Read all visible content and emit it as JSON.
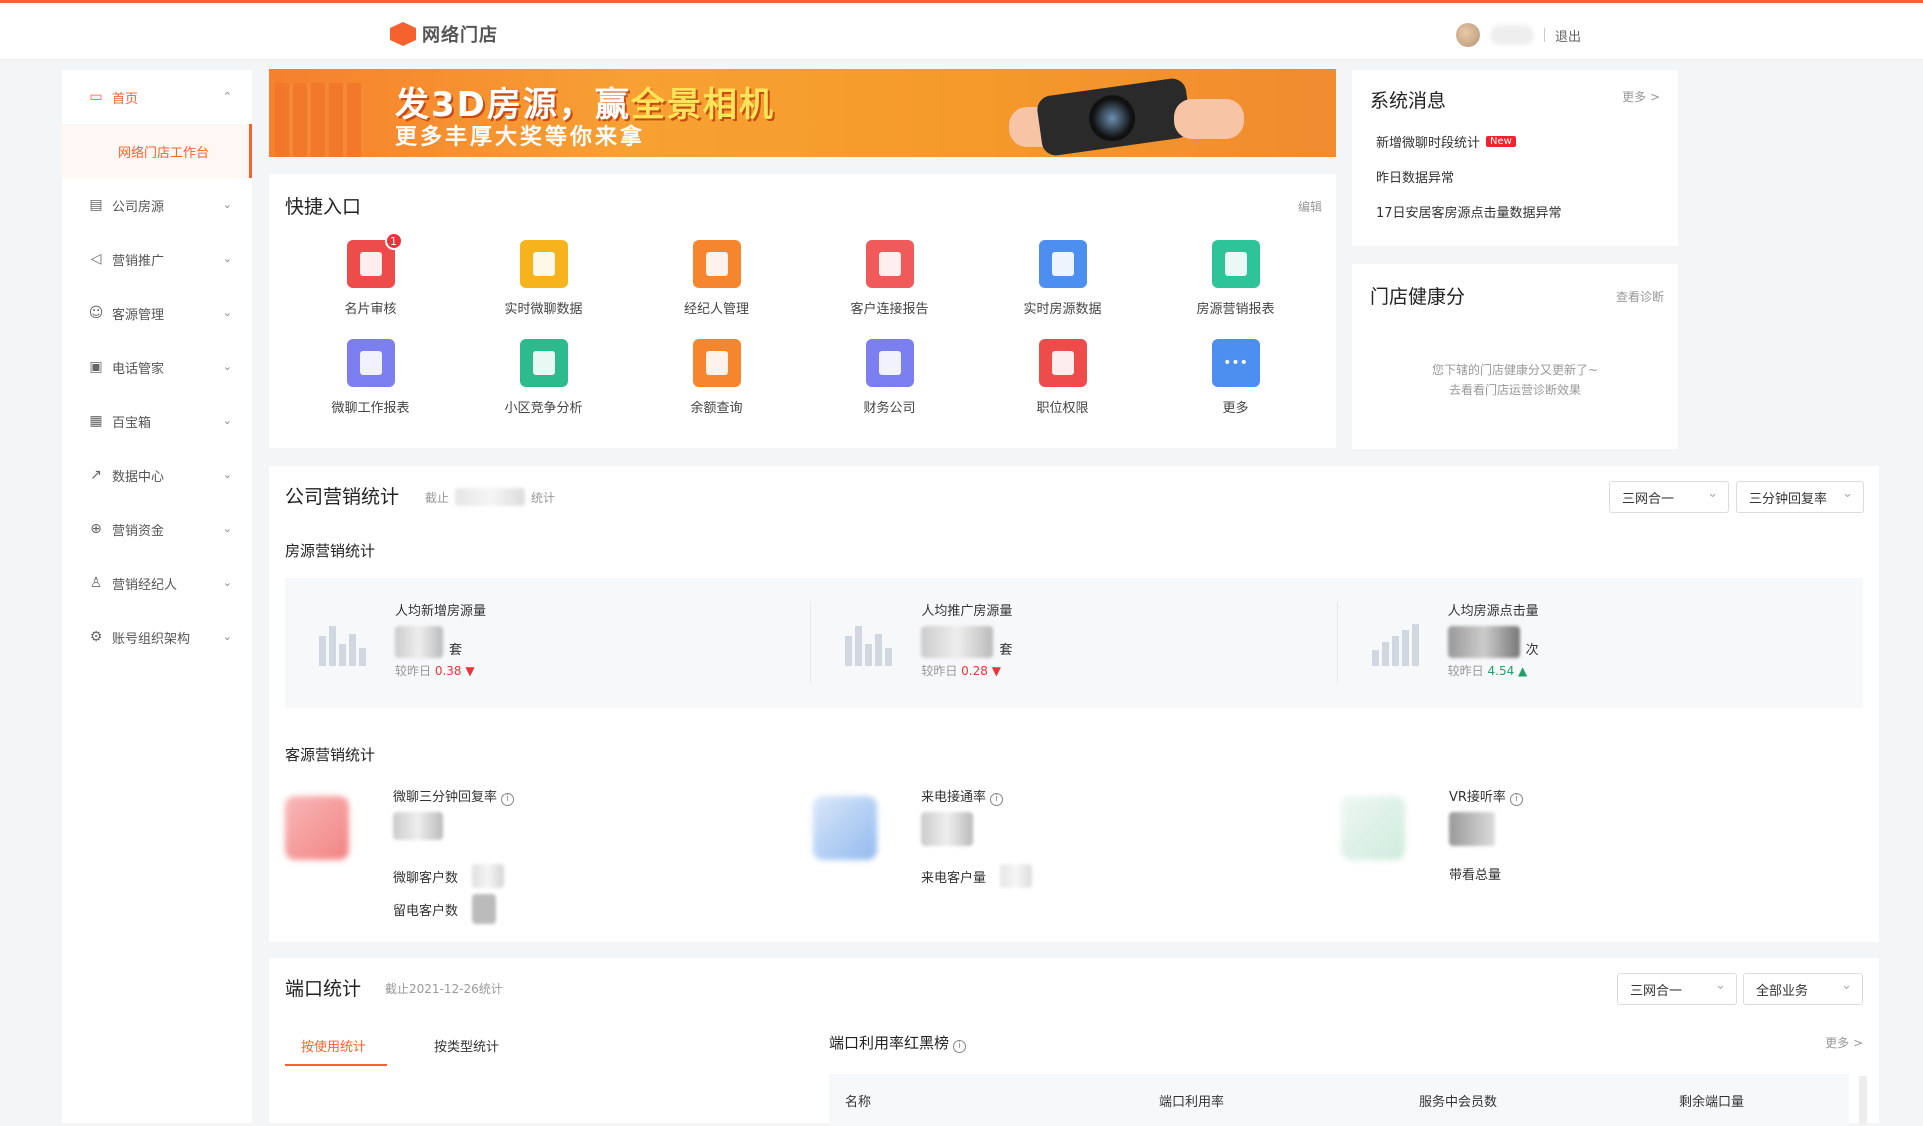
{
  "header": {
    "logo_text": "网络门店",
    "logout": "退出"
  },
  "sidebar": {
    "items": [
      {
        "label": "首页",
        "icon": "monitor-icon",
        "glyph": "▭",
        "chevron": "⌃",
        "active": true
      },
      {
        "label": "公司房源",
        "icon": "building-icon",
        "glyph": "▤",
        "chevron": "⌄"
      },
      {
        "label": "营销推广",
        "icon": "send-icon",
        "glyph": "◁",
        "chevron": "⌄"
      },
      {
        "label": "客源管理",
        "icon": "users-icon",
        "glyph": "☺",
        "chevron": "⌄"
      },
      {
        "label": "电话管家",
        "icon": "briefcase-icon",
        "glyph": "▣",
        "chevron": "⌄"
      },
      {
        "label": "百宝箱",
        "icon": "box-icon",
        "glyph": "▦",
        "chevron": "⌄"
      },
      {
        "label": "数据中心",
        "icon": "line-chart-icon",
        "glyph": "↗",
        "chevron": "⌄"
      },
      {
        "label": "营销资金",
        "icon": "globe-icon",
        "glyph": "⊕",
        "chevron": "⌄"
      },
      {
        "label": "营销经纪人",
        "icon": "person-icon",
        "glyph": "♙",
        "chevron": "⌄"
      },
      {
        "label": "账号组织架构",
        "icon": "gear-icon",
        "glyph": "⚙",
        "chevron": "⌄"
      }
    ],
    "sub_active": "网络门店工作台"
  },
  "banner": {
    "line1_a": "发3D房源，赢",
    "line1_b": "全景相机",
    "line2": "更多丰厚大奖等你来拿"
  },
  "quick": {
    "title": "快捷入口",
    "edit": "编辑",
    "items": [
      {
        "label": "名片审核",
        "color": "#ee4b4b",
        "badge": "1"
      },
      {
        "label": "实时微聊数据",
        "color": "#f6b31c"
      },
      {
        "label": "经纪人管理",
        "color": "#f5862d"
      },
      {
        "label": "客户连接报告",
        "color": "#f05a5a"
      },
      {
        "label": "实时房源数据",
        "color": "#4d8ff0"
      },
      {
        "label": "房源营销报表",
        "color": "#2ec49a"
      },
      {
        "label": "微聊工作报表",
        "color": "#7b7ff0"
      },
      {
        "label": "小区竞争分析",
        "color": "#2dbb8e"
      },
      {
        "label": "余额查询",
        "color": "#f5862d"
      },
      {
        "label": "财务公司",
        "color": "#7b7ff0"
      },
      {
        "label": "职位权限",
        "color": "#ee4b4b"
      },
      {
        "label": "更多",
        "color": "#4d8ff0",
        "glyph": "•••"
      }
    ]
  },
  "system": {
    "title": "系统消息",
    "more": "更多 >",
    "new_tag": "New",
    "items": [
      "新增微聊时段统计",
      "昨日数据异常",
      "17日安居客房源点击量数据异常"
    ]
  },
  "health": {
    "title": "门店健康分",
    "link": "查看诊断",
    "msg1": "您下辖的门店健康分又更新了~",
    "msg2": "去看看门店运营诊断效果"
  },
  "stats": {
    "title": "公司营销统计",
    "as_of": "截止",
    "stat_suffix": "统计",
    "select1": "三网合一",
    "select2": "三分钟回复率",
    "house_title": "房源营销统计",
    "house": [
      {
        "label": "人均新增房源量",
        "unit": "套",
        "cmp_label": "较昨日",
        "cmp": "0.38",
        "arrow": "▼",
        "trend": "down"
      },
      {
        "label": "人均推广房源量",
        "unit": "套",
        "cmp_label": "较昨日",
        "cmp": "0.28",
        "arrow": "▼",
        "trend": "down"
      },
      {
        "label": "人均房源点击量",
        "unit": "次",
        "cmp_label": "较昨日",
        "cmp": "4.54",
        "arrow": "▲",
        "trend": "up"
      }
    ],
    "cust_title": "客源营销统计",
    "cust": [
      {
        "label": "微聊三分钟回复率",
        "rows": [
          "微聊客户数",
          "留电客户数"
        ]
      },
      {
        "label": "来电接通率",
        "rows": [
          "来电客户量"
        ]
      },
      {
        "label": "VR接听率",
        "rows": [
          "带看总量"
        ]
      }
    ]
  },
  "port": {
    "title": "端口统计",
    "as_of": "截止2021-12-26统计",
    "select1": "三网合一",
    "select2": "全部业务",
    "tab_active": "按使用统计",
    "tab_other": "按类型统计",
    "rank_title": "端口利用率红黑榜",
    "more": "更多 >",
    "columns": [
      "名称",
      "端口利用率",
      "服务中会员数",
      "剩余端口量"
    ]
  },
  "info_glyph": "i"
}
